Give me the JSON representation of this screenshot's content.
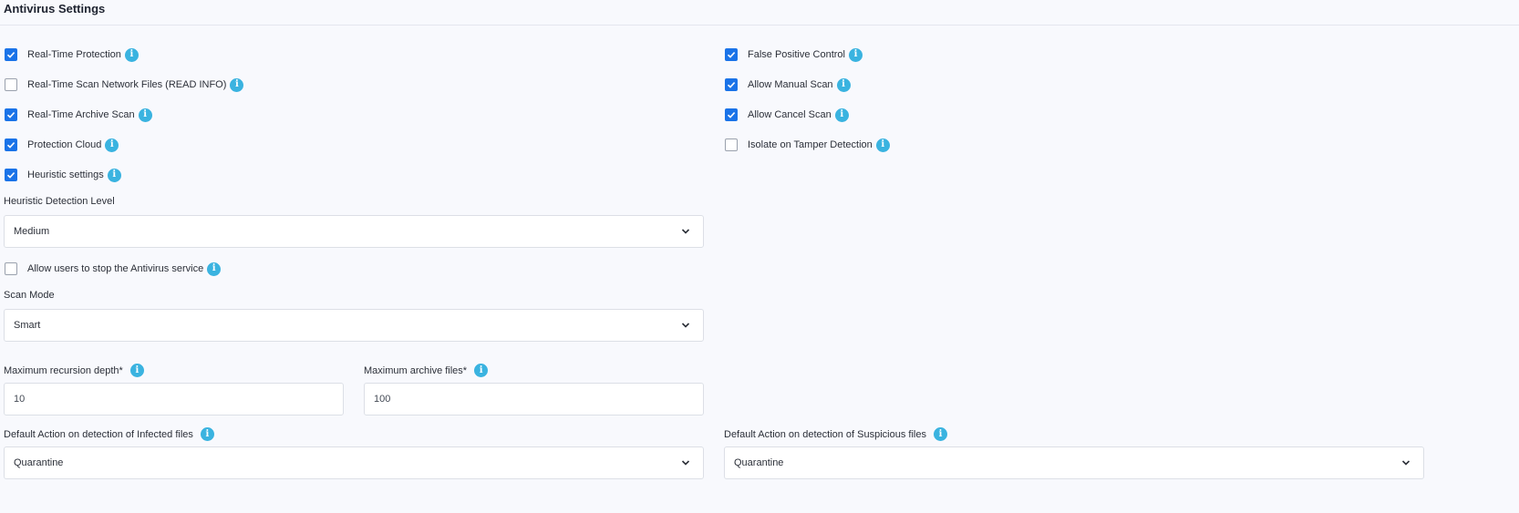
{
  "header": {
    "title": "Antivirus Settings"
  },
  "left_checkboxes": [
    {
      "label": "Real-Time Protection",
      "checked": true
    },
    {
      "label": "Real-Time Scan Network Files (READ INFO)",
      "checked": false
    },
    {
      "label": "Real-Time Archive Scan",
      "checked": true
    },
    {
      "label": "Protection Cloud",
      "checked": true
    },
    {
      "label": "Heuristic settings",
      "checked": true
    }
  ],
  "right_checkboxes": [
    {
      "label": "False Positive Control",
      "checked": true
    },
    {
      "label": "Allow Manual Scan",
      "checked": true
    },
    {
      "label": "Allow Cancel Scan",
      "checked": true
    },
    {
      "label": "Isolate on Tamper Detection",
      "checked": false
    }
  ],
  "heuristic_level": {
    "label": "Heuristic Detection Level",
    "value": "Medium"
  },
  "stop_service": {
    "label": "Allow users to stop the Antivirus service",
    "checked": false
  },
  "scan_mode": {
    "label": "Scan Mode",
    "value": "Smart"
  },
  "max_recursion": {
    "label": "Maximum recursion depth*",
    "value": "10"
  },
  "max_archive": {
    "label": "Maximum archive files*",
    "value": "100"
  },
  "infected_action": {
    "label": "Default Action on detection of Infected files",
    "value": "Quarantine"
  },
  "suspicious_action": {
    "label": "Default Action on detection of Suspicious files",
    "value": "Quarantine"
  },
  "icons": {
    "info": "i"
  },
  "colors": {
    "accent": "#1a73e8",
    "info": "#3ab3e0",
    "background": "#f8f9fd"
  }
}
